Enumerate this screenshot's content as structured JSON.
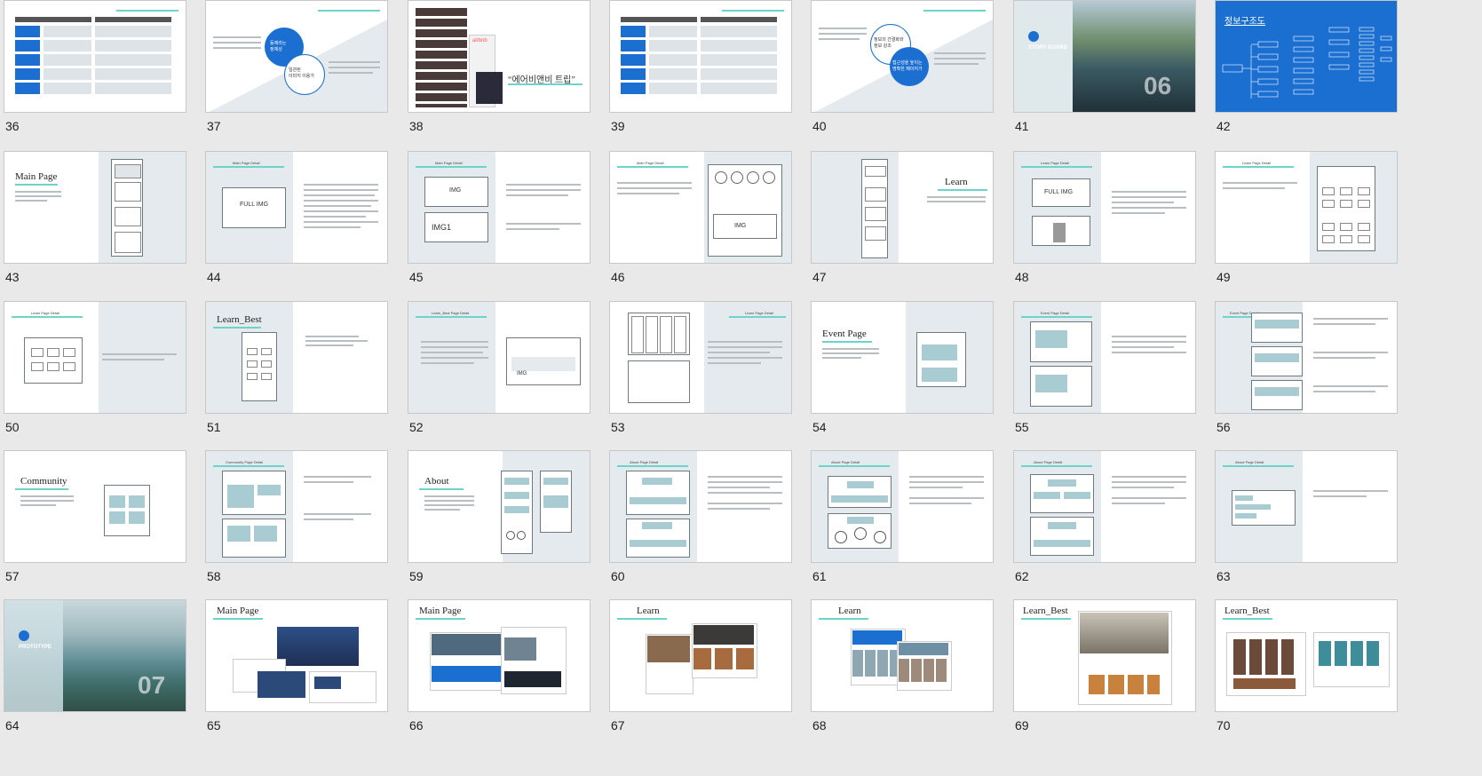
{
  "slides": {
    "s36": {
      "num": "36"
    },
    "s37": {
      "num": "37",
      "circle_a": "동제라는\n정체성",
      "circle_b": "일관된\n이미지 이용가"
    },
    "s38": {
      "num": "38",
      "quote": "“에어비앤비 트립”",
      "logo": "airbnb"
    },
    "s39": {
      "num": "39"
    },
    "s40": {
      "num": "40",
      "circle_a": "정보의 간결화와\n정보 강조",
      "circle_b": "접근성을 높이는\n명확한 페이지가"
    },
    "s41": {
      "num": "41",
      "label": "STORY BOARD",
      "big": "06"
    },
    "s42": {
      "num": "42",
      "title": "정보구조도"
    },
    "s43": {
      "num": "43",
      "title": "Main Page"
    },
    "s44": {
      "num": "44",
      "hdr": "Main Page Detail",
      "img": "FULL IMG"
    },
    "s45": {
      "num": "45",
      "hdr": "Main Page Detail",
      "img": "IMG",
      "img1": "IMG1"
    },
    "s46": {
      "num": "46",
      "hdr": "Main Page Detail",
      "img": "IMG"
    },
    "s47": {
      "num": "47",
      "title": "Learn"
    },
    "s48": {
      "num": "48",
      "hdr": "Learn Page Detail",
      "img": "FULL IMG"
    },
    "s49": {
      "num": "49",
      "hdr": "Learn Page Detail"
    },
    "s50": {
      "num": "50",
      "hdr": "Learn Page Detail"
    },
    "s51": {
      "num": "51",
      "title": "Learn_Best"
    },
    "s52": {
      "num": "52",
      "hdr": "Learn_Best Page Detail",
      "img": "IMG"
    },
    "s53": {
      "num": "53",
      "hdr": "Learn Page Detail"
    },
    "s54": {
      "num": "54",
      "title": "Event Page"
    },
    "s55": {
      "num": "55",
      "hdr": "Event Page Detail"
    },
    "s56": {
      "num": "56",
      "hdr": "Event Page Detail"
    },
    "s57": {
      "num": "57",
      "title": "Community"
    },
    "s58": {
      "num": "58",
      "hdr": "Community Page Detail"
    },
    "s59": {
      "num": "59",
      "title": "About"
    },
    "s60": {
      "num": "60",
      "hdr": "About Page Detail"
    },
    "s61": {
      "num": "61",
      "hdr": "About Page Detail"
    },
    "s62": {
      "num": "62",
      "hdr": "About Page Detail"
    },
    "s63": {
      "num": "63",
      "hdr": "About Page Detail"
    },
    "s64": {
      "num": "64",
      "label": "PROTOTYPE",
      "big": "07"
    },
    "s65": {
      "num": "65",
      "title": "Main Page"
    },
    "s66": {
      "num": "66",
      "title": "Main Page"
    },
    "s67": {
      "num": "67",
      "title": "Learn"
    },
    "s68": {
      "num": "68",
      "title": "Learn"
    },
    "s69": {
      "num": "69",
      "title": "Learn_Best"
    },
    "s70": {
      "num": "70",
      "title": "Learn_Best"
    }
  },
  "colors": {
    "accent": "#6fd4c8",
    "blue": "#1b6fd0",
    "panel": "#e4eaed",
    "bg": "#e9e9e9"
  }
}
